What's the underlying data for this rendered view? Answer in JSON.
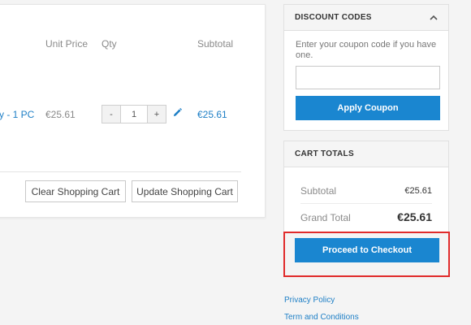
{
  "cart": {
    "headers": {
      "unit_price": "Unit Price",
      "qty": "Qty",
      "subtotal": "Subtotal"
    },
    "item": {
      "name": "y - 1 PC",
      "unit_price": "€25.61",
      "qty": "1",
      "qty_minus": "-",
      "qty_plus": "+",
      "subtotal": "€25.61",
      "edit_icon": "pencil-icon"
    },
    "actions": {
      "clear_label": "Clear Shopping Cart",
      "update_label": "Update Shopping Cart"
    }
  },
  "discount": {
    "title": "DISCOUNT CODES",
    "toggle_icon": "chevron-up-icon",
    "hint": "Enter your coupon code if you have one.",
    "input_value": "",
    "apply_label": "Apply Coupon"
  },
  "totals": {
    "title": "CART TOTALS",
    "subtotal_label": "Subtotal",
    "subtotal_value": "€25.61",
    "grand_total_label": "Grand Total",
    "grand_total_value": "€25.61",
    "checkout_label": "Proceed to Checkout"
  },
  "footer": {
    "links": [
      "Privacy Policy",
      "Term and Conditions"
    ]
  },
  "colors": {
    "primary": "#1a86d0",
    "link": "#1e7fc6",
    "highlight": "#e02b2b"
  }
}
